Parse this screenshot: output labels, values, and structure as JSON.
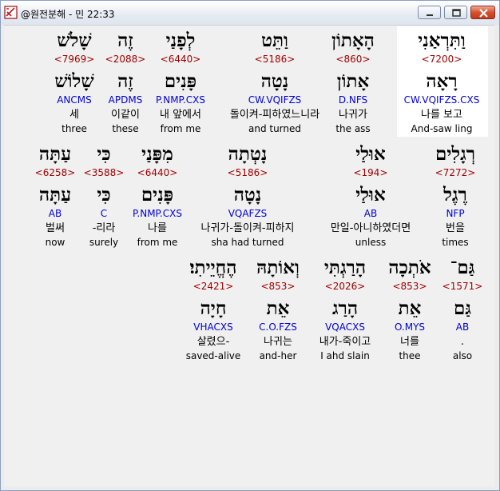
{
  "window": {
    "title": "@원전분해 - 민 22:33"
  },
  "rows": [
    [
      {
        "heb": "וַתִּרְאַנִי",
        "strong": "<7200>",
        "lemma": "רָאָה",
        "morph": "CW.VQIFZS.CXS",
        "kor": "나를 보고",
        "eng": "And-saw ling"
      },
      {
        "heb": "הָאָתוֹן",
        "strong": "<860>",
        "lemma": "אָתוֹן",
        "morph": "D.NFS",
        "kor": "나귀가",
        "eng": "the ass"
      },
      {
        "heb": "וַתֵּט",
        "strong": "<5186>",
        "lemma": "נָטָה",
        "morph": "CW.VQIFZS",
        "kor": "돌이켜-피하였느니라",
        "eng": "and turned"
      },
      {
        "heb": "לְפָנַי",
        "strong": "<6440>",
        "lemma": "פָּנִים",
        "morph": "P.NMP.CXS",
        "kor": "내 앞에서",
        "eng": "from me"
      },
      {
        "heb": "זֶה",
        "strong": "<2088>",
        "lemma": "זֶה",
        "morph": "APDMS",
        "kor": "이같이",
        "eng": "these"
      },
      {
        "heb": "שָׁלֹשׁ",
        "strong": "<7969>",
        "lemma": "שָׁלוֹשׁ",
        "morph": "ANCMS",
        "kor": "세",
        "eng": "three"
      }
    ],
    [
      {
        "heb": "רְגָלִים",
        "strong": "<7272>",
        "lemma": "רֶגֶל",
        "morph": "NFP",
        "kor": "번을",
        "eng": "times"
      },
      {
        "heb": "אוּלַי",
        "strong": "<194>",
        "lemma": "אוּלַי",
        "morph": "AB",
        "kor": "만일-아니하였더면",
        "eng": "unless"
      },
      {
        "heb": "נָטְתָה",
        "strong": "<5186>",
        "lemma": "נָטָה",
        "morph": "VQAFZS",
        "kor": "나귀가-돌이켜-피하지",
        "eng": "sha had turned"
      },
      {
        "heb": "מִפָּנַי",
        "strong": "<6440>",
        "lemma": "פָּנִים",
        "morph": "P.NMP.CXS",
        "kor": "나를",
        "eng": "from me"
      },
      {
        "heb": "כִּי",
        "strong": "<3588>",
        "lemma": "כִּי",
        "morph": "C",
        "kor": "-리라",
        "eng": "surely"
      },
      {
        "heb": "עַתָּה",
        "strong": "<6258>",
        "lemma": "עַתָּה",
        "morph": "AB",
        "kor": "벌써",
        "eng": "now"
      }
    ],
    [
      {
        "heb": "גַּם־",
        "strong": "<1571>",
        "lemma": "גַּם",
        "morph": "AB",
        "kor": ".",
        "eng": "also"
      },
      {
        "heb": "אֹתְכָה",
        "strong": "<853>",
        "lemma": "אֵת",
        "morph": "O.MYS",
        "kor": "너를",
        "eng": "thee"
      },
      {
        "heb": "הָרַגְתִּי",
        "strong": "<2026>",
        "lemma": "הָרַג",
        "morph": "VQACXS",
        "kor": "내가-죽이고",
        "eng": "I ahd slain"
      },
      {
        "heb": "וְאוֹתָהּ",
        "strong": "<853>",
        "lemma": "אֵת",
        "morph": "C.O.FZS",
        "kor": "나귀는",
        "eng": "and-her"
      },
      {
        "heb": "הֶחֱיֵיתִי׃",
        "strong": "<2421>",
        "lemma": "חָיָה",
        "morph": "VHACXS",
        "kor": "살렸으-",
        "eng": "saved-alive"
      }
    ]
  ]
}
